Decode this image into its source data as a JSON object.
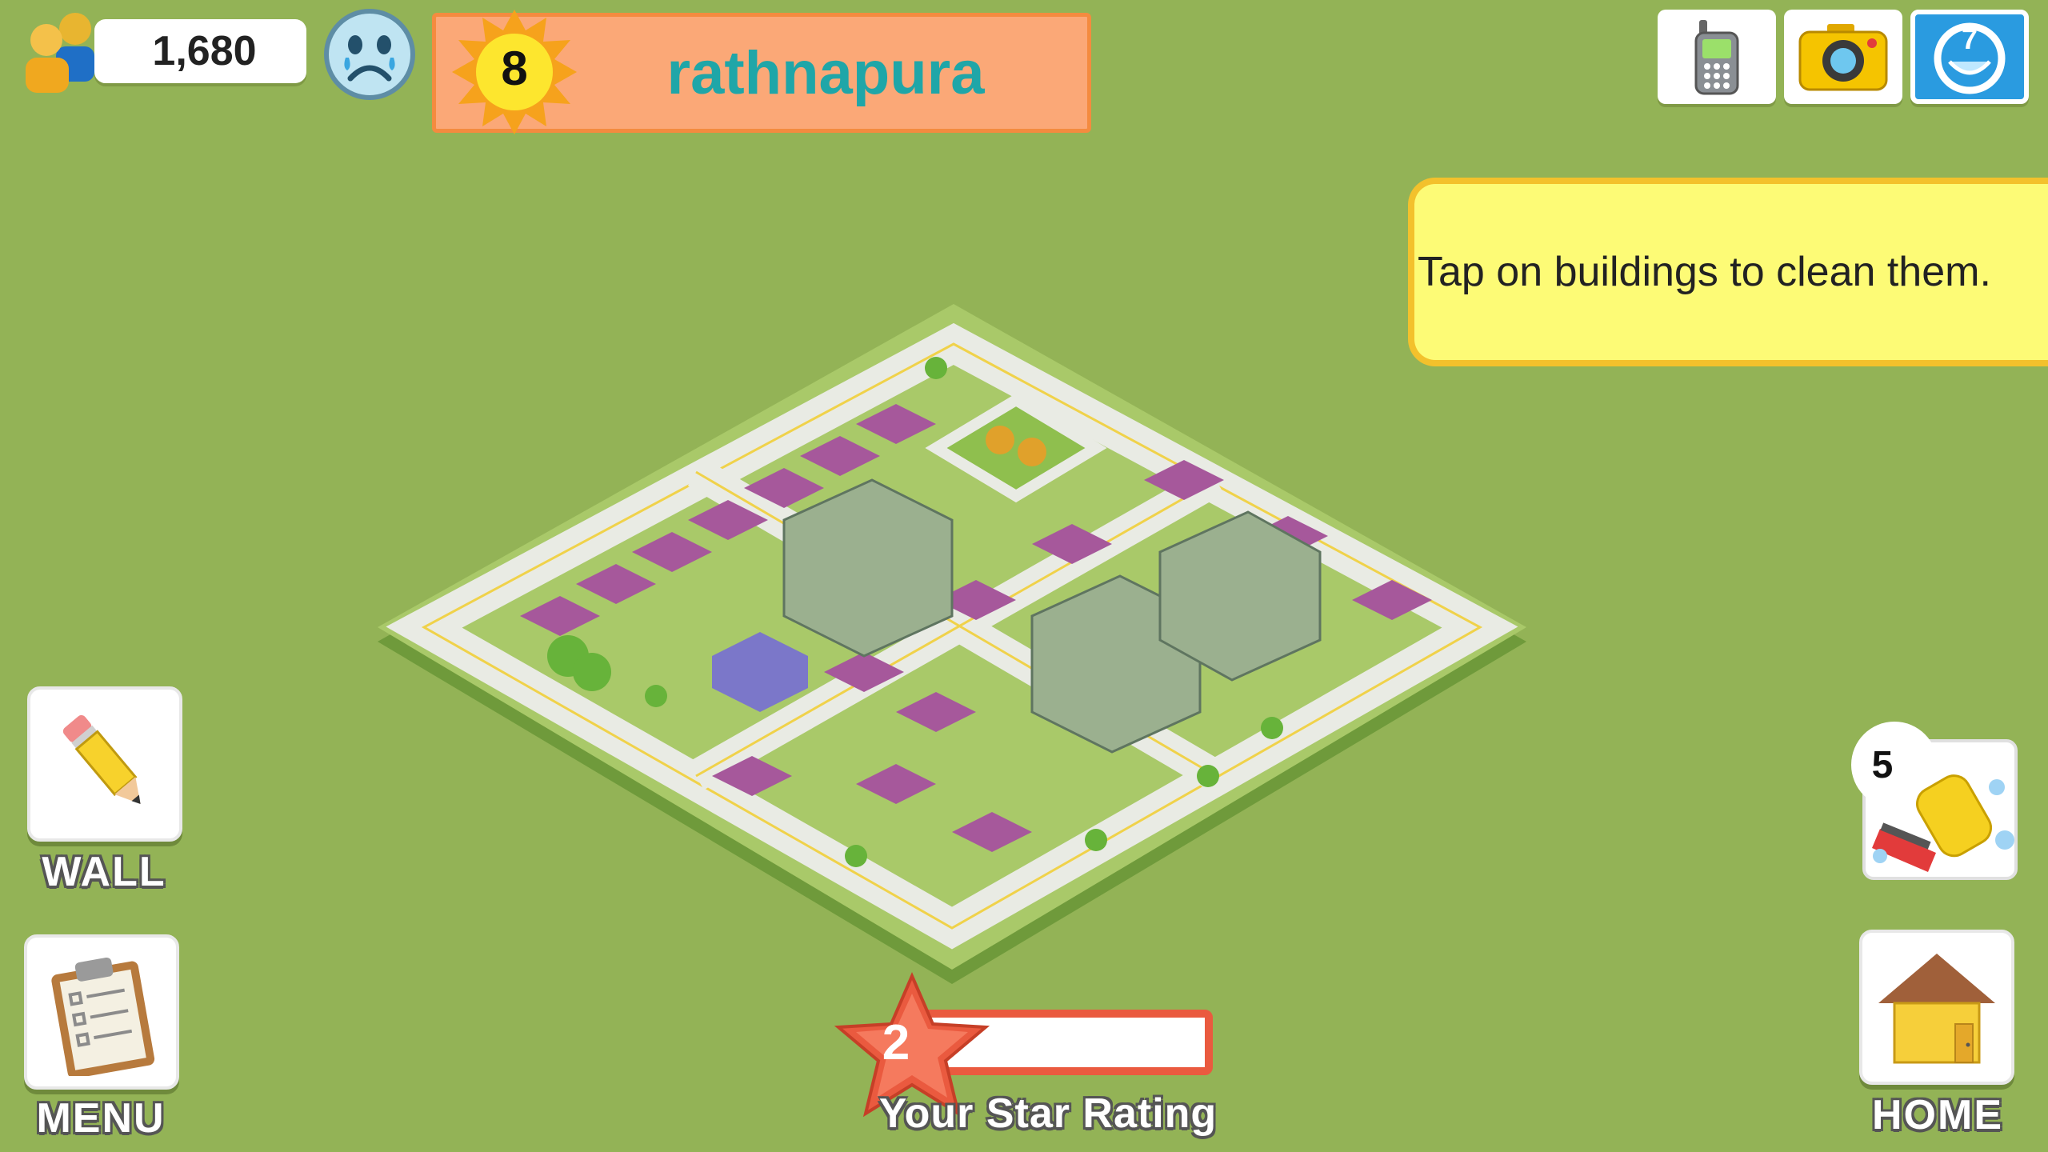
{
  "header": {
    "population": "1,680",
    "level": "8",
    "city_name": "rathnapura"
  },
  "hint": {
    "text": "Tap on buildings to clean them."
  },
  "left_buttons": {
    "wall_label": "WALL",
    "menu_label": "MENU"
  },
  "right_buttons": {
    "home_label": "HOME",
    "clean_count": "5"
  },
  "rating": {
    "value": "2",
    "label": "Your Star Rating",
    "progress": 0
  },
  "icons": {
    "population": "people-icon",
    "mood": "sad-face-icon",
    "phone": "phone-icon",
    "camera": "camera-icon",
    "blue": "refresh-icon",
    "wall": "pencil-icon",
    "menu": "clipboard-icon",
    "home": "house-icon",
    "clean": "sponge-icon"
  },
  "colors": {
    "background": "#93b356",
    "banner": "#fba877",
    "city_text": "#1fa6a8",
    "hint_bg": "#fdfb76",
    "rating": "#ea5a3f"
  }
}
